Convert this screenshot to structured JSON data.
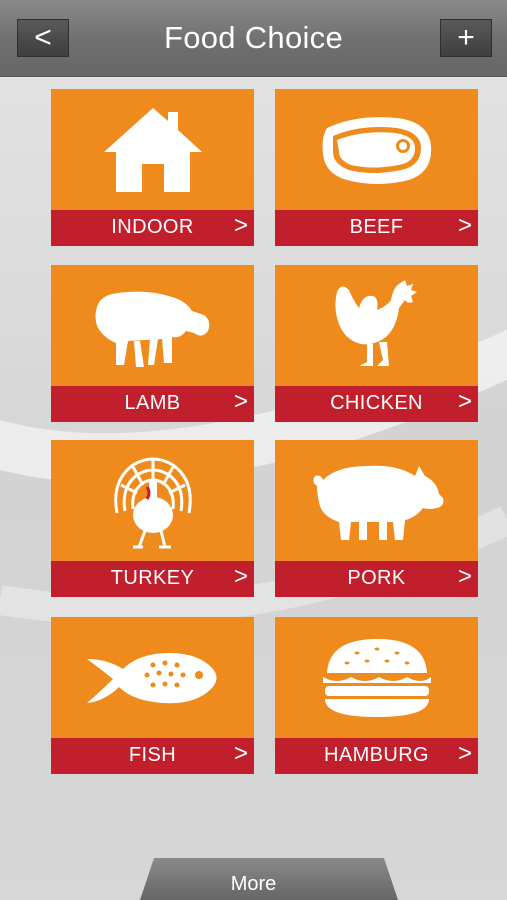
{
  "header": {
    "title": "Food Choice",
    "back_label": "<",
    "add_label": "+"
  },
  "tiles": [
    {
      "label": "INDOOR",
      "icon": "house-icon",
      "chevron": ">"
    },
    {
      "label": "BEEF",
      "icon": "steak-icon",
      "chevron": ">"
    },
    {
      "label": "LAMB",
      "icon": "lamb-icon",
      "chevron": ">"
    },
    {
      "label": "CHICKEN",
      "icon": "chicken-icon",
      "chevron": ">"
    },
    {
      "label": "TURKEY",
      "icon": "turkey-icon",
      "chevron": ">"
    },
    {
      "label": "PORK",
      "icon": "pig-icon",
      "chevron": ">"
    },
    {
      "label": "FISH",
      "icon": "fish-icon",
      "chevron": ">"
    },
    {
      "label": "HAMBURG",
      "icon": "hamburger-icon",
      "chevron": ">"
    }
  ],
  "footer": {
    "more_label": "More"
  },
  "colors": {
    "tile": "#ef8a1c",
    "tile_bar": "#c21f2c",
    "header": "#707070",
    "background": "#dcdcdc"
  }
}
